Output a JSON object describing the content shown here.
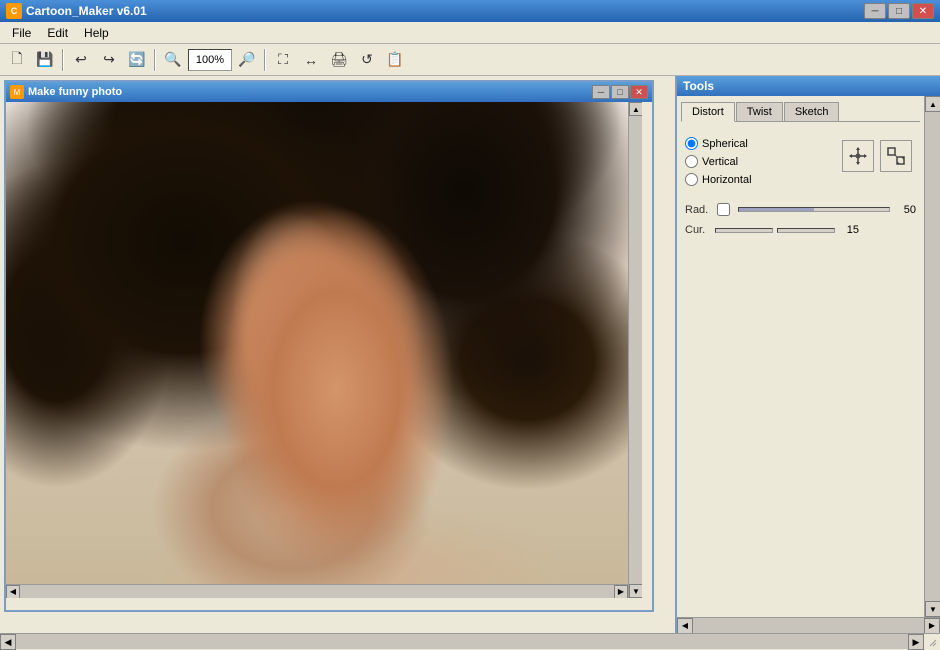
{
  "app": {
    "title": "Cartoon_Maker v6.01",
    "icon": "C"
  },
  "titlebar": {
    "minimize": "─",
    "maximize": "□",
    "close": "✕"
  },
  "menu": {
    "items": [
      "File",
      "Edit",
      "Help"
    ]
  },
  "toolbar": {
    "zoom_value": "100%",
    "buttons": [
      "💾",
      "📂",
      "↩",
      "↪",
      "🔄",
      "🔍",
      "🔎",
      "⛶",
      "➡",
      "🖨",
      "🔃",
      "📋"
    ]
  },
  "inner_window": {
    "title": "Make funny photo",
    "icon": "M"
  },
  "tools": {
    "title": "Tools",
    "tabs": [
      "Distort",
      "Twist",
      "Sketch"
    ],
    "active_tab": "Distort",
    "distort": {
      "options": [
        "Spherical",
        "Vertical",
        "Horizontal"
      ],
      "selected": "Spherical",
      "rad_label": "Rad.",
      "rad_value": "50",
      "cur_label": "Cur.",
      "cur_value": "15"
    }
  },
  "scroll": {
    "left_arrow": "◀",
    "right_arrow": "▶",
    "up_arrow": "▲",
    "down_arrow": "▼"
  }
}
